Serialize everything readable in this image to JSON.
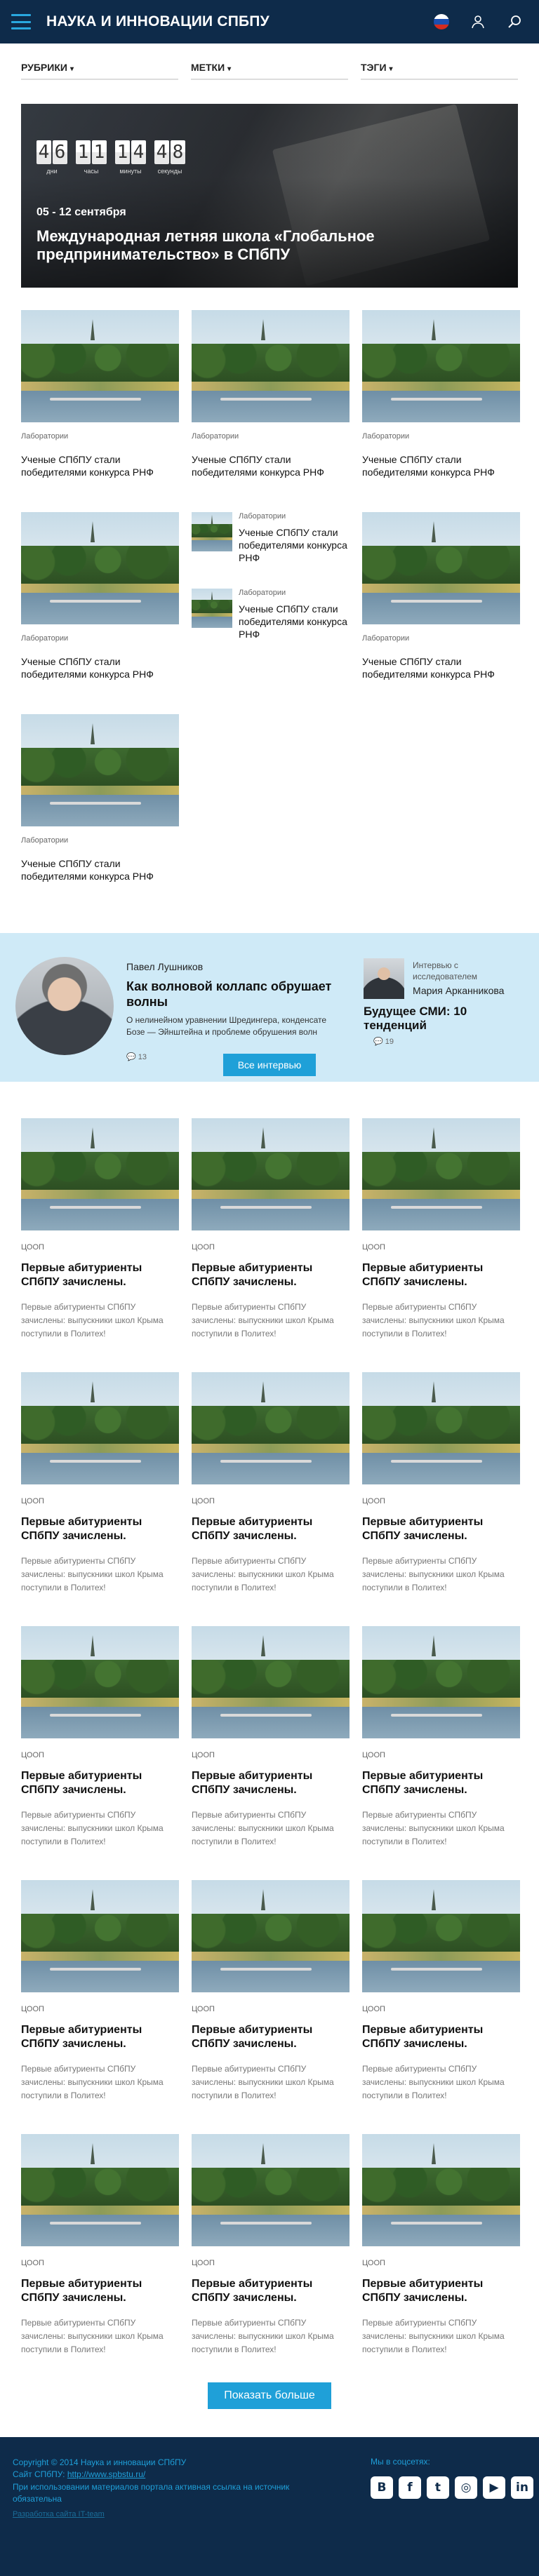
{
  "header": {
    "title": "НАУКА И ИННОВАЦИИ СПБПУ",
    "icons": [
      "menu-icon",
      "russian-flag-icon",
      "user-icon",
      "search-icon"
    ]
  },
  "filters": {
    "rubrics": "РУБРИКИ",
    "tags": "МЕТКИ",
    "topics": "ТЭГИ"
  },
  "hero": {
    "countdown": {
      "days": {
        "digits": [
          "4",
          "6"
        ],
        "label": "дни"
      },
      "hours": {
        "digits": [
          "1",
          "1"
        ],
        "label": "часы"
      },
      "minutes": {
        "digits": [
          "1",
          "4"
        ],
        "label": "минуты"
      },
      "seconds": {
        "digits": [
          "4",
          "8"
        ],
        "label": "секунды"
      }
    },
    "date": "05 - 12 сентября",
    "title": "Международная летняя школа «Глобальное предпринимательство» в СПбПУ"
  },
  "labs": [
    {
      "tag": "Лаборатории",
      "title": "Ученые СПбПУ стали победителями конкурса РНФ"
    },
    {
      "tag": "Лаборатории",
      "title": "Ученые СПбПУ стали победителями конкурса РНФ"
    },
    {
      "tag": "Лаборатории",
      "title": "Ученые СПбПУ стали победителями конкурса РНФ"
    },
    {
      "tag": "Лаборатории",
      "title": "Ученые СПбПУ стали победителями конкурса РНФ"
    },
    {
      "tag": "Лаборатории",
      "title": "Ученые СПбПУ стали победителями конкурса РНФ"
    },
    {
      "tag": "Лаборатории",
      "title": "Ученые СПбПУ стали победителями конкурса РНФ"
    },
    {
      "tag": "Лаборатории",
      "title": "Ученые СПбПУ стали победителями конкурса РНФ"
    },
    {
      "tag": "Лаборатории",
      "title": "Ученые СПбПУ стали победителями конкурса РНФ"
    }
  ],
  "interview": {
    "name": "Павел Лушников",
    "title": "Как волновой коллапс обрушает волны",
    "desc": "О нелинейном уравнении Шредингера, конденсате Бозе — Эйнштейна и проблеме обрушения волн",
    "comments": "13",
    "button": "Все интервью",
    "side_label": "Интервью с исследователем",
    "side_name": "Мария Арканникова",
    "side_title": "Будущее СМИ: 10 тенденций",
    "side_comments": "19"
  },
  "news": [
    {
      "tag": "ЦООП",
      "title": "Первые абитуриенты СПбПУ зачислены.",
      "desc": "Первые абитуриенты СПбПУ зачислены: выпускники школ Крыма поступили в Политех!"
    },
    {
      "tag": "ЦООП",
      "title": "Первые абитуриенты СПбПУ зачислены.",
      "desc": "Первые абитуриенты СПбПУ зачислены: выпускники школ Крыма поступили в Политех!"
    },
    {
      "tag": "ЦООП",
      "title": "Первые абитуриенты СПбПУ зачислены.",
      "desc": "Первые абитуриенты СПбПУ зачислены: выпускники школ Крыма поступили в Политех!"
    },
    {
      "tag": "ЦООП",
      "title": "Первые абитуриенты СПбПУ зачислены.",
      "desc": "Первые абитуриенты СПбПУ зачислены: выпускники школ Крыма поступили в Политех!"
    },
    {
      "tag": "ЦООП",
      "title": "Первые абитуриенты СПбПУ зачислены.",
      "desc": "Первые абитуриенты СПбПУ зачислены: выпускники школ Крыма поступили в Политех!"
    },
    {
      "tag": "ЦООП",
      "title": "Первые абитуриенты СПбПУ зачислены.",
      "desc": "Первые абитуриенты СПбПУ зачислены: выпускники школ Крыма поступили в Политех!"
    },
    {
      "tag": "ЦООП",
      "title": "Первые абитуриенты СПбПУ зачислены.",
      "desc": "Первые абитуриенты СПбПУ зачислены: выпускники школ Крыма поступили в Политех!"
    },
    {
      "tag": "ЦООП",
      "title": "Первые абитуриенты СПбПУ зачислены.",
      "desc": "Первые абитуриенты СПбПУ зачислены: выпускники школ Крыма поступили в Политех!"
    },
    {
      "tag": "ЦООП",
      "title": "Первые абитуриенты СПбПУ зачислены.",
      "desc": "Первые абитуриенты СПбПУ зачислены: выпускники школ Крыма поступили в Политех!"
    },
    {
      "tag": "ЦООП",
      "title": "Первые абитуриенты СПбПУ зачислены.",
      "desc": "Первые абитуриенты СПбПУ зачислены: выпускники школ Крыма поступили в Политех!"
    },
    {
      "tag": "ЦООП",
      "title": "Первые абитуриенты СПбПУ зачислены.",
      "desc": "Первые абитуриенты СПбПУ зачислены: выпускники школ Крыма поступили в Политех!"
    },
    {
      "tag": "ЦООП",
      "title": "Первые абитуриенты СПбПУ зачислены.",
      "desc": "Первые абитуриенты СПбПУ зачислены: выпускники школ Крыма поступили в Политех!"
    },
    {
      "tag": "ЦООП",
      "title": "Первые абитуриенты СПбПУ зачислены.",
      "desc": "Первые абитуриенты СПбПУ зачислены: выпускники школ Крыма поступили в Политех!"
    },
    {
      "tag": "ЦООП",
      "title": "Первые абитуриенты СПбПУ зачислены.",
      "desc": "Первые абитуриенты СПбПУ зачислены: выпускники школ Крыма поступили в Политех!"
    },
    {
      "tag": "ЦООП",
      "title": "Первые абитуриенты СПбПУ зачислены.",
      "desc": "Первые абитуриенты СПбПУ зачислены: выпускники школ Крыма поступили в Политех!"
    }
  ],
  "load_more": "Показать больше",
  "footer": {
    "copyright": "Copyright © 2014 Наука и инновации СПбПУ",
    "site_label": "Сайт СПбПУ:",
    "site_url": "http://www.spbstu.ru/",
    "notice": "При использовании материалов портала активная ссылка на источник обязательна",
    "dev": "Разработка сайта IT-team",
    "social_label": "Мы в соцсетях:",
    "social": [
      {
        "name": "vk-icon",
        "glyph": "В"
      },
      {
        "name": "facebook-icon",
        "glyph": "f"
      },
      {
        "name": "twitter-icon",
        "glyph": "t"
      },
      {
        "name": "instagram-icon",
        "glyph": "◎"
      },
      {
        "name": "youtube-icon",
        "glyph": "▶"
      },
      {
        "name": "linkedin-icon",
        "glyph": "in"
      }
    ]
  }
}
